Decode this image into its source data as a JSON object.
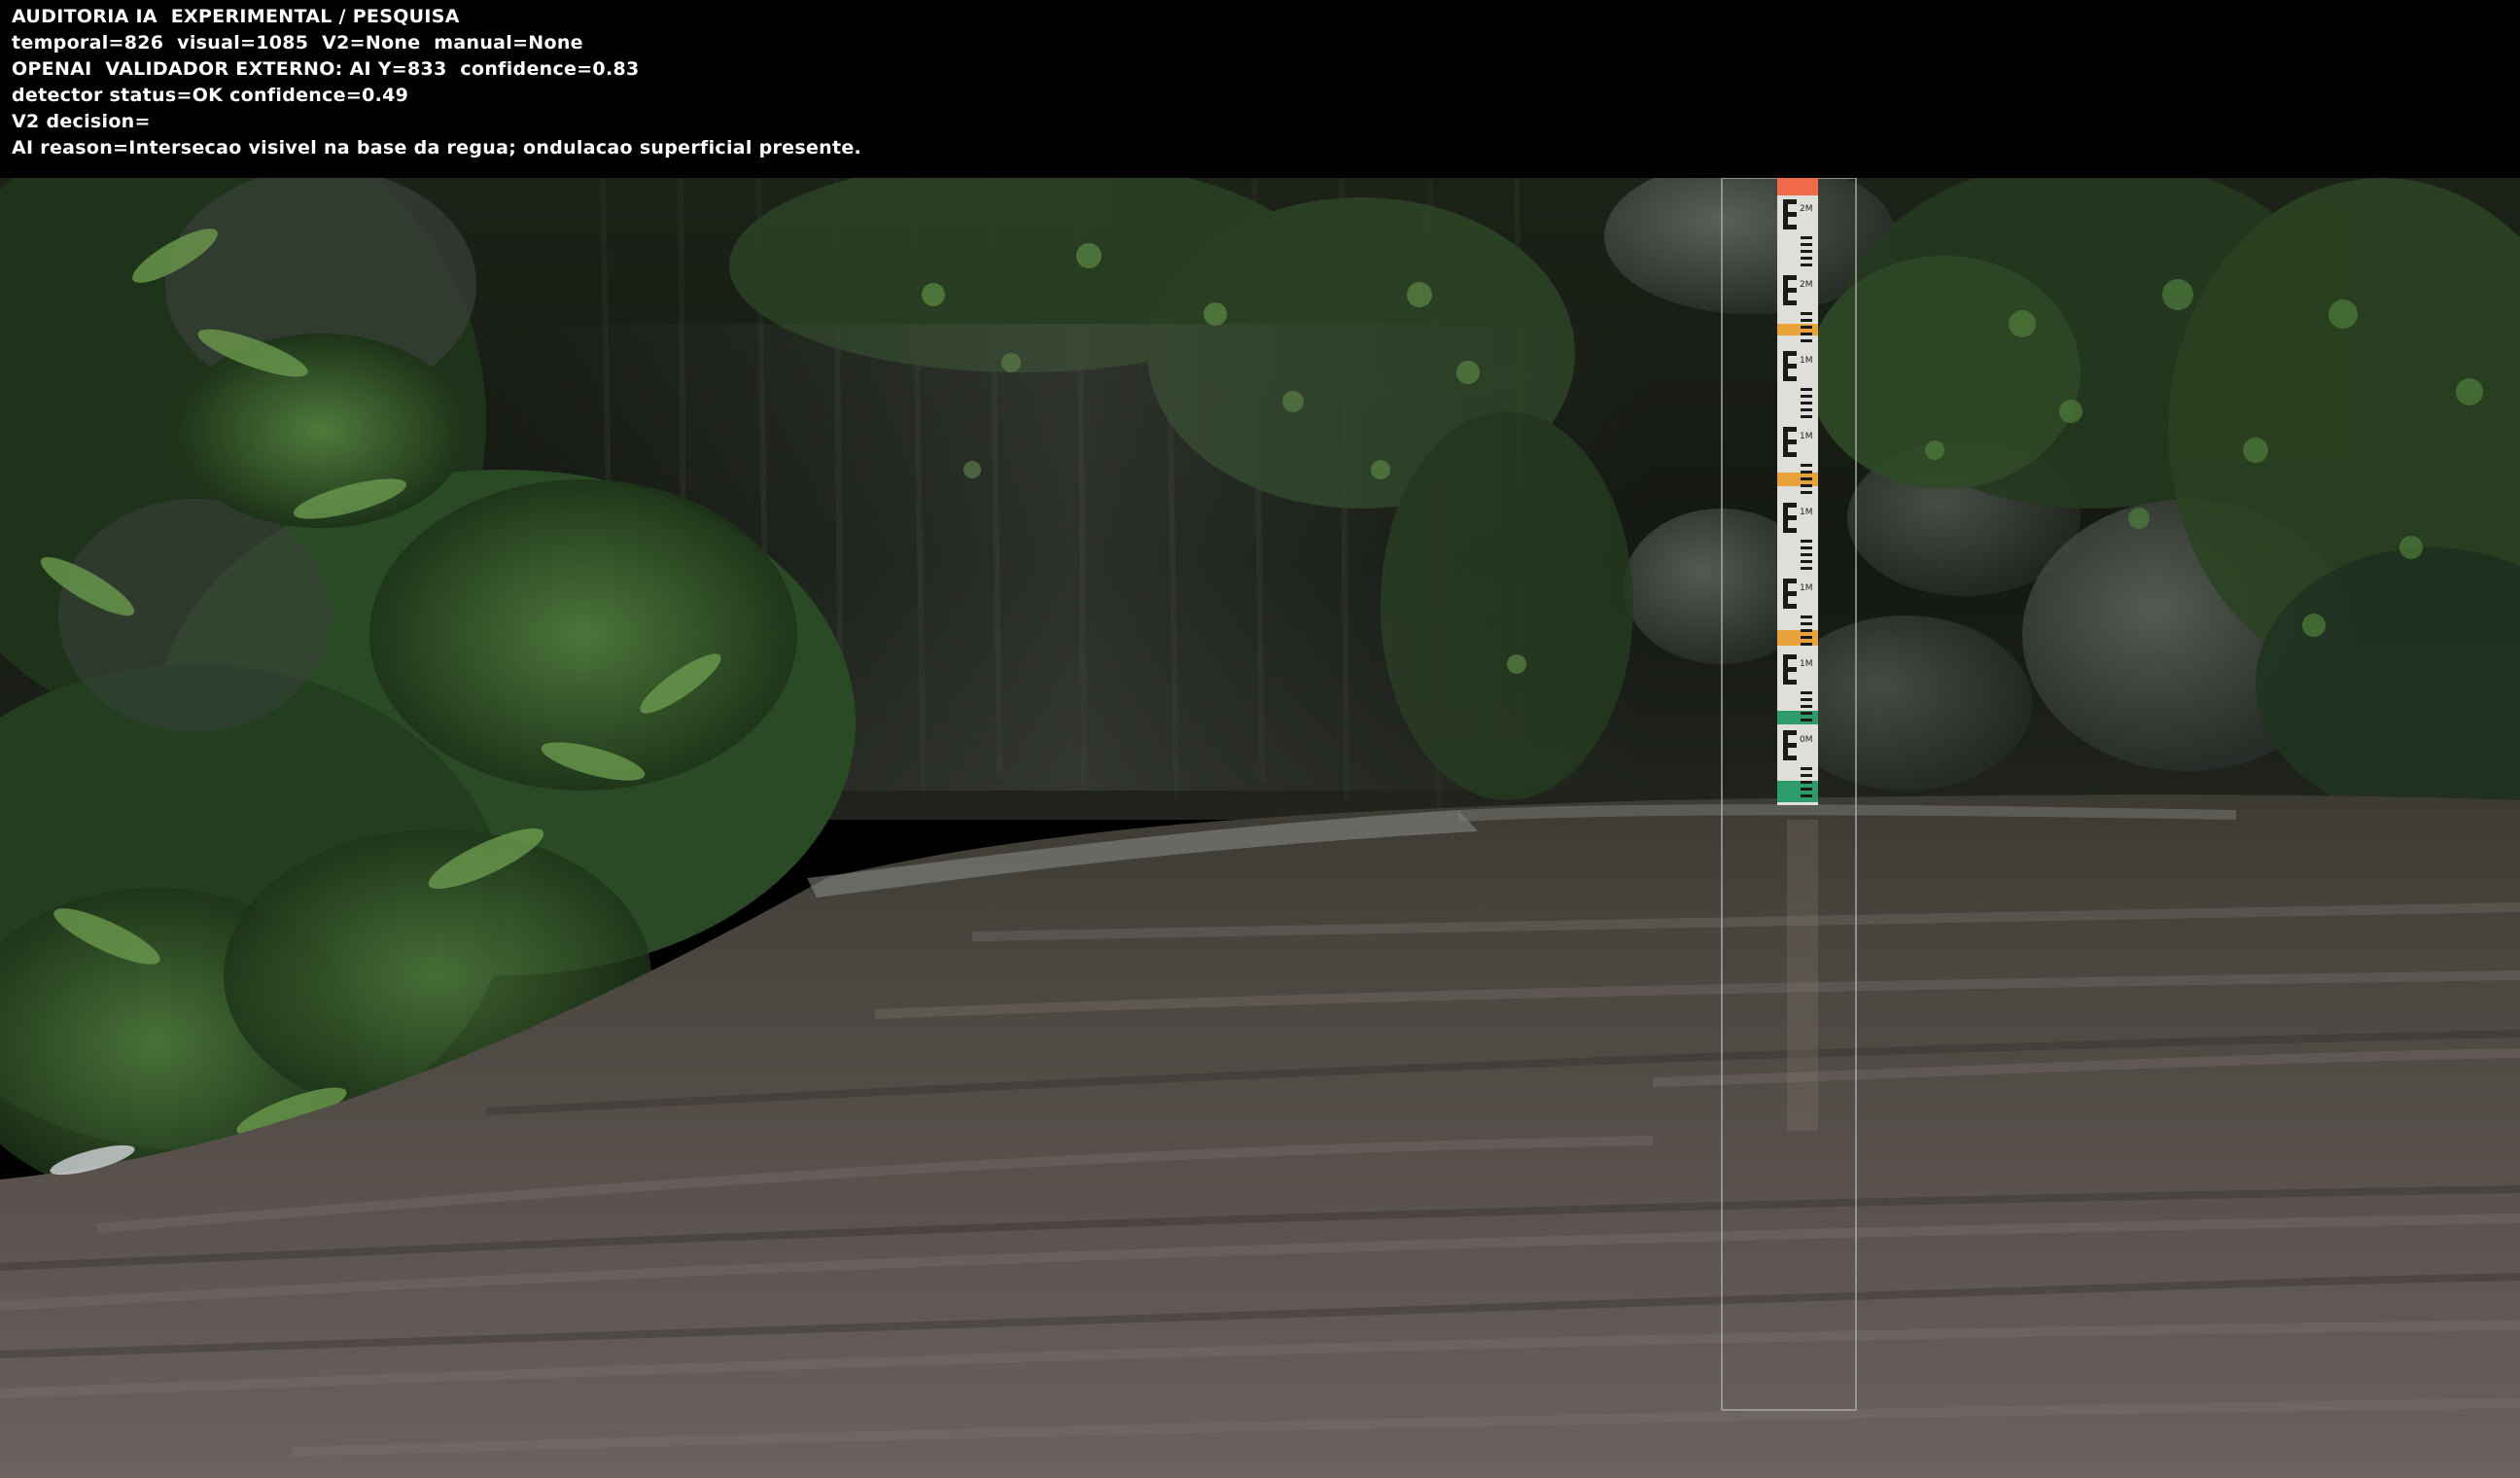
{
  "overlay": {
    "line1": "AUDITORIA IA  EXPERIMENTAL / PESQUISA",
    "line2": "temporal=826  visual=1085  V2=None  manual=None",
    "line3": "OPENAI  VALIDADOR EXTERNO: AI Y=833  confidence=0.83",
    "line4": "detector status=OK confidence=0.49",
    "line5": "V2 decision=",
    "line6": "AI reason=Intersecao visivel na base da regua; ondulacao superficial presente."
  },
  "gauge": {
    "segments": [
      {
        "label": "2M 30 2M",
        "color": "#e8e8e2"
      },
      {
        "label": "2M 10 2M",
        "color": "#e8e8e2"
      },
      {
        "label": "1M 90 1M",
        "color": "#e8e8e2"
      },
      {
        "label": "1M 70 1M",
        "color": "#e8e8e2"
      },
      {
        "label": "1M 50 1M",
        "color": "#e8e8e2"
      },
      {
        "label": "1M 30 1M",
        "color": "#e8e8e2"
      },
      {
        "label": "1M 10 1M",
        "color": "#e8e8e2"
      },
      {
        "label": "0M 90",
        "color": "#e8e8e2"
      }
    ],
    "band_colors": [
      "#f06a4a",
      "#e9a23a",
      "#e9a23a",
      "#e9a23a",
      "#2d9b6a",
      "#2d9b6a"
    ]
  }
}
